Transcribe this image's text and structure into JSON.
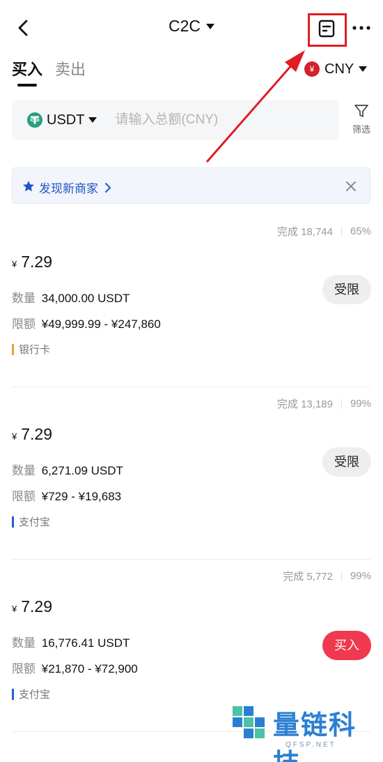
{
  "header": {
    "title": "C2C",
    "colors": {
      "highlight": "#e21c22",
      "accent_buy": "#f0384e",
      "link": "#2154c4"
    }
  },
  "tabs": [
    {
      "label": "买入",
      "active": true
    },
    {
      "label": "卖出",
      "active": false
    }
  ],
  "currency": {
    "badge": "¥",
    "label": "CNY"
  },
  "search": {
    "asset": "USDT",
    "placeholder": "请输入总额(CNY)",
    "value": ""
  },
  "filter": {
    "label": "筛选"
  },
  "discover": {
    "label": "发现新商家"
  },
  "labels": {
    "quantity": "数量",
    "limit": "限额",
    "yen": "¥"
  },
  "offers": [
    {
      "completed": "完成 18,744",
      "rate": "65%",
      "price": "7.29",
      "quantity": "34,000.00 USDT",
      "limit": "¥49,999.99 - ¥247,860",
      "payment": "银行卡",
      "payment_color": "#f0a030",
      "action": "受限"
    },
    {
      "completed": "完成 13,189",
      "rate": "99%",
      "price": "7.29",
      "quantity": "6,271.09 USDT",
      "limit": "¥729 - ¥19,683",
      "payment": "支付宝",
      "payment_color": "#2a5bd6",
      "action": "受限"
    },
    {
      "completed": "完成 5,772",
      "rate": "99%",
      "price": "7.29",
      "quantity": "16,776.41 USDT",
      "limit": "¥21,870 - ¥72,900",
      "payment": "支付宝",
      "payment_color": "#2a5bd6",
      "action": "买入"
    }
  ],
  "watermark": {
    "name": "量链科技",
    "sub": "QFSP.NET"
  }
}
